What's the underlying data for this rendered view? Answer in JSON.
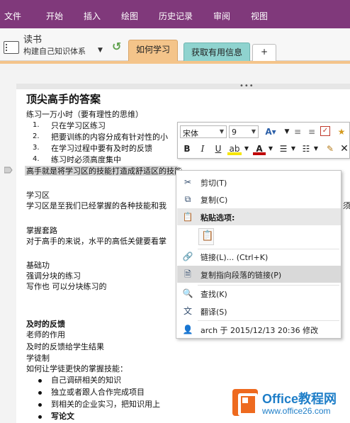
{
  "ribbon": {
    "tabs": [
      "文件",
      "开始",
      "插入",
      "绘图",
      "历史记录",
      "审阅",
      "视图"
    ],
    "background": "#80397b"
  },
  "notebook": {
    "title": "读书",
    "section_label": "构建自己知识体系",
    "section_tabs": [
      {
        "label": "如何学习",
        "color": "#f4c48a"
      },
      {
        "label": "获取有用信息",
        "color": "#8fd3cf"
      }
    ],
    "add_tab_label": "+"
  },
  "page": {
    "title": "顶尖高手的答案",
    "line1": "练习一万小时（要有理性的思维）",
    "numbered": [
      {
        "n": "1.",
        "text": "只在学习区练习"
      },
      {
        "n": "2.",
        "text": "把要训练的内容分成有针对性的小"
      },
      {
        "n": "3.",
        "text": "在学习过程中要有及时的反馈"
      },
      {
        "n": "4.",
        "text": "练习时必须高度集中"
      }
    ],
    "selected_line": "高手就是将学习区的技能打造成舒适区的技能",
    "xuexiqu_title": "学习区",
    "xuexiqu_body": "学习区是至我们已经掌握的各种技能和我",
    "xuexiqu_tail": "须",
    "zhangwo_title": "掌握套路",
    "zhangwo_body": "对于高手的来说，水平的高低关健要看掌",
    "jichu_title": "基础功",
    "jichu_l1": "强调分块的练习",
    "jichu_l2": "写作也  可以分块练习的",
    "feedback_title": "及时的反馈",
    "feedback_l1": "老师的作用",
    "feedback_l2": "及时的反馈给学生结果",
    "feedback_l3": "学徒制",
    "feedback_l4": "如何让学徒更快的掌握技能：",
    "bullets": [
      "自己调研相关的知识",
      "独立或者跟人合作完成项目",
      "到相关的企业实习，把知识用上"
    ],
    "last_bullet": "写论文"
  },
  "mini_toolbar": {
    "font_name": "宋体",
    "font_size": "9",
    "bold": "B",
    "italic": "I",
    "underline": "U"
  },
  "context_menu": {
    "cut": "剪切(T)",
    "copy": "复制(C)",
    "paste_options": "粘贴选项:",
    "link": "链接(L)...    (Ctrl+K)",
    "copy_link": "复制指向段落的链接(P)",
    "find": "查找(K)",
    "translate": "翻译(S)",
    "author": "arch 于 2015/12/13 20:36 修改"
  },
  "watermark": {
    "brand": "Office教程网",
    "url": "www.office26.com"
  }
}
